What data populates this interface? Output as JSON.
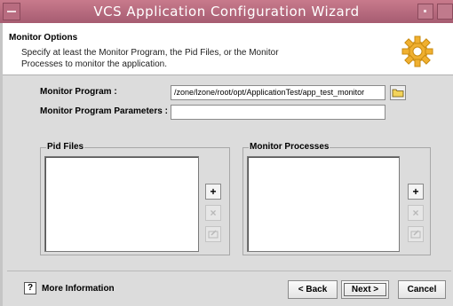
{
  "window": {
    "title": "VCS Application Configuration Wizard"
  },
  "header": {
    "title": "Monitor Options",
    "description": "Specify at least the Monitor Program, the Pid Files, or the Monitor Processes to monitor the application."
  },
  "form": {
    "monitor_program_label": "Monitor Program :",
    "monitor_program_value": "/zone/lzone/root/opt/ApplicationTest/app_test_monitor",
    "monitor_params_label": "Monitor Program Parameters :",
    "monitor_params_value": ""
  },
  "pid_files": {
    "title": "Pid Files",
    "items": [],
    "add_label": "+",
    "remove_label": "×"
  },
  "monitor_processes": {
    "title": "Monitor Processes",
    "items": [],
    "add_label": "+",
    "remove_label": "×"
  },
  "footer": {
    "help_label": "?",
    "more_info_label": "More Information",
    "back_label": "< Back",
    "next_label": "Next >",
    "cancel_label": "Cancel"
  },
  "colors": {
    "titlebar": "#b46a7e",
    "gear": "#f0b030"
  },
  "icons": {
    "folder": "folder-icon",
    "gear": "gear-icon",
    "help": "help-icon",
    "edit": "edit-icon"
  }
}
